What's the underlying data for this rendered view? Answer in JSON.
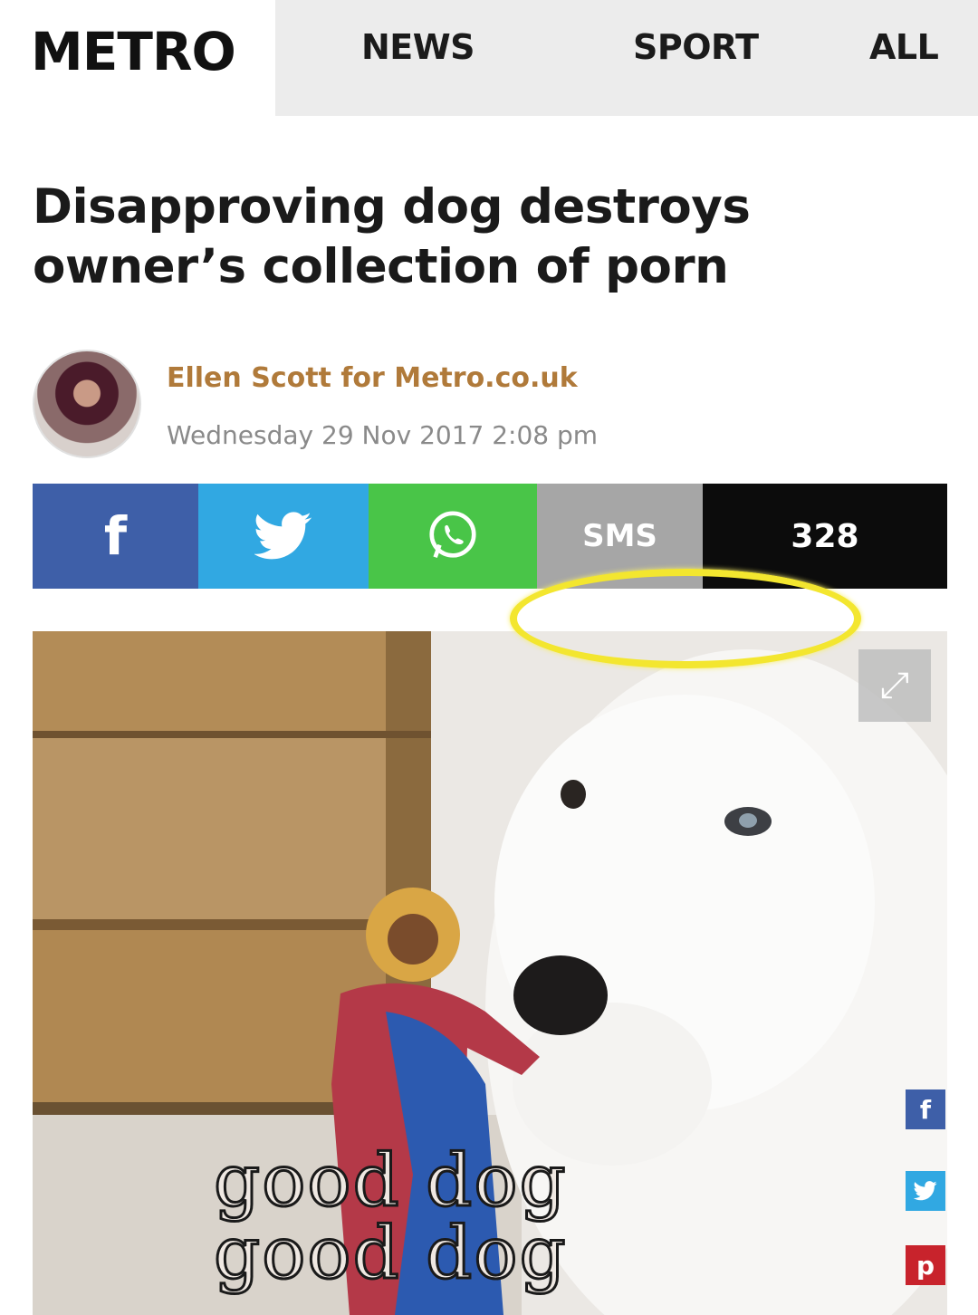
{
  "header": {
    "logo": "METRO",
    "nav": [
      "NEWS",
      "SPORT",
      "ALL"
    ]
  },
  "article": {
    "headline_line1": "Disapproving dog destroys",
    "headline_line2": "owner’s collection of porn",
    "author": "Ellen Scott for Metro.co.uk",
    "date": "Wednesday 29 Nov 2017 2:08 pm"
  },
  "sharebar": {
    "facebook": "f",
    "sms": "SMS",
    "count": "328"
  },
  "photo": {
    "caption_line1": "good dog",
    "caption_line2": "good dog",
    "side_facebook": "f",
    "side_pinterest": "p"
  },
  "colors": {
    "facebook": "#3e5fa8",
    "twitter": "#31a8e2",
    "whatsapp": "#49c548",
    "sms": "#a6a6a6",
    "count": "#0c0c0c",
    "author": "#b07a3a",
    "halo": "#f3e62f"
  },
  "icons": [
    "twitter-bird-icon",
    "whatsapp-icon",
    "expand-icon"
  ]
}
